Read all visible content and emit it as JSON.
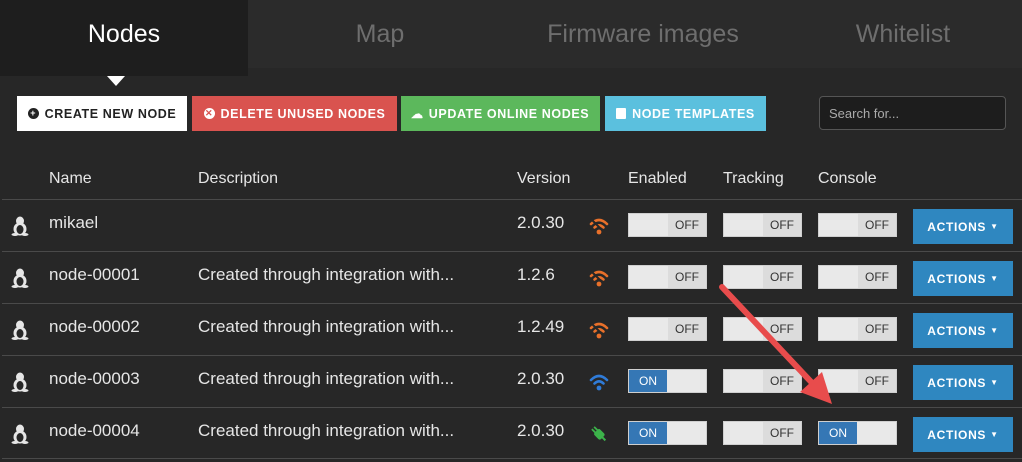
{
  "tabs": [
    {
      "label": "Nodes",
      "active": true
    },
    {
      "label": "Map",
      "active": false
    },
    {
      "label": "Firmware images",
      "active": false
    },
    {
      "label": "Whitelist",
      "active": false
    }
  ],
  "toolbar": {
    "create_label": "CREATE NEW NODE",
    "delete_label": "DELETE UNUSED NODES",
    "update_label": "UPDATE ONLINE NODES",
    "templates_label": "NODE TEMPLATES",
    "search_placeholder": "Search for..."
  },
  "table": {
    "headers": {
      "name": "Name",
      "description": "Description",
      "version": "Version",
      "enabled": "Enabled",
      "tracking": "Tracking",
      "console": "Console"
    },
    "rows": [
      {
        "name": "mikael",
        "description": "",
        "version": "2.0.30",
        "signal": "wifi-orange-icon",
        "enabled": "OFF",
        "tracking": "OFF",
        "console": "OFF",
        "actions": "ACTIONS"
      },
      {
        "name": "node-00001",
        "description": "Created through integration with...",
        "version": "1.2.6",
        "signal": "wifi-orange-icon",
        "enabled": "OFF",
        "tracking": "OFF",
        "console": "OFF",
        "actions": "ACTIONS"
      },
      {
        "name": "node-00002",
        "description": "Created through integration with...",
        "version": "1.2.49",
        "signal": "wifi-orange-icon",
        "enabled": "OFF",
        "tracking": "OFF",
        "console": "OFF",
        "actions": "ACTIONS"
      },
      {
        "name": "node-00003",
        "description": "Created through integration with...",
        "version": "2.0.30",
        "signal": "wifi-blue-icon",
        "enabled": "ON",
        "tracking": "OFF",
        "console": "OFF",
        "actions": "ACTIONS"
      },
      {
        "name": "node-00004",
        "description": "Created through integration with...",
        "version": "2.0.30",
        "signal": "plug-green-icon",
        "enabled": "ON",
        "tracking": "OFF",
        "console": "ON",
        "actions": "ACTIONS"
      }
    ]
  },
  "colors": {
    "wifi_orange": "#e8702a",
    "wifi_blue": "#2f7bd8",
    "plug_green": "#3cb34a",
    "toggle_on": "#3577b5",
    "actions_button": "#2f87c0",
    "annotation_arrow": "#e84c4c"
  }
}
